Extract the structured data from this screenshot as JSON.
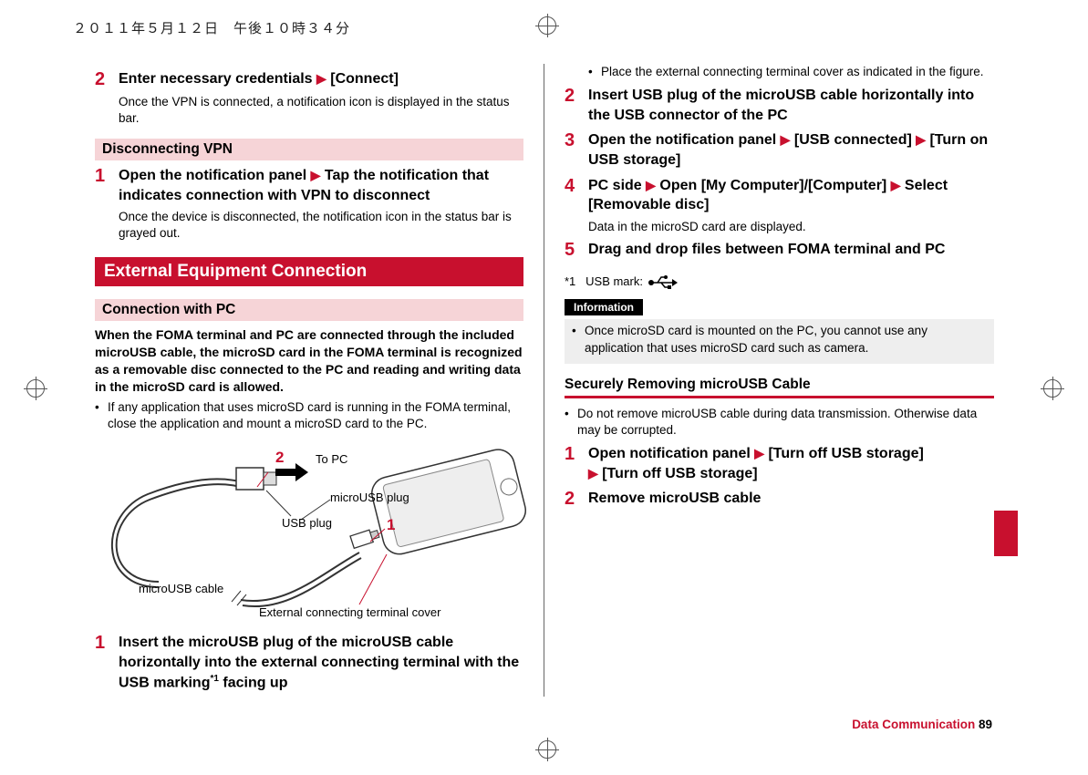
{
  "timestamp": "２０１１年５月１２日　午後１０時３４分",
  "left": {
    "step2": {
      "title_before": "Enter necessary credentials ",
      "title_after": " [Connect]",
      "sub": "Once the VPN is connected, a notification icon is displayed in the status bar."
    },
    "disconnecting_heading": "Disconnecting VPN",
    "disc_step1": {
      "title_before": "Open the notification panel ",
      "title_after": " Tap the notification that indicates connection with VPN to disconnect",
      "sub": "Once the device is disconnected, the notification icon in the status bar is grayed out."
    },
    "section_heading": "External Equipment Connection",
    "connection_heading": "Connection with PC",
    "intro": "When the FOMA terminal and PC are connected through the included microUSB cable, the microSD card in the FOMA terminal is recognized as a removable disc connected to the PC and reading and writing data in the microSD card is allowed.",
    "intro_bullet": "If any application that uses microSD card is running in the FOMA terminal, close the application and mount a microSD card to the PC.",
    "figure": {
      "to_pc": "To PC",
      "micro_usb_plug": "microUSB plug",
      "usb_plug": "USB plug",
      "micro_usb_cable": "microUSB cable",
      "ext_cover": "External connecting terminal cover",
      "marker1": "1",
      "marker2": "2"
    },
    "conn_step1": {
      "title": "Insert the microUSB plug of the microUSB cable horizontally into the external connecting terminal with the USB marking",
      "sup": "*1",
      "title_end": " facing up"
    }
  },
  "right": {
    "cont_bullet": "Place the external connecting terminal cover as indicated in the figure.",
    "step2": "Insert USB plug of the microUSB cable horizontally into the USB connector of the PC",
    "step3_before": "Open the notification panel ",
    "step3_mid": " [USB connected] ",
    "step3_after": " [Turn on USB storage]",
    "step4_before": "PC side ",
    "step4_mid": " Open [My Computer]/[Computer] ",
    "step4_after": " Select [Removable disc]",
    "step4_sub": "Data in the microSD card are displayed.",
    "step5": "Drag and drop files between FOMA terminal and PC",
    "footnote_label": "*1",
    "footnote_text": "USB mark:",
    "info_label": "Information",
    "info_text": "Once microSD card is mounted on the PC, you cannot use any application that uses microSD card such as camera.",
    "secure_heading": "Securely Removing microUSB Cable",
    "secure_bullet": "Do not remove microUSB cable during data transmission. Otherwise data may be corrupted.",
    "sec_step1_before": "Open notification panel ",
    "sec_step1_mid": " [Turn off USB storage] ",
    "sec_step1_after": " [Turn off USB storage]",
    "sec_step2": "Remove microUSB cable"
  },
  "footer": {
    "chapter": "Data Communication",
    "page": "89"
  }
}
